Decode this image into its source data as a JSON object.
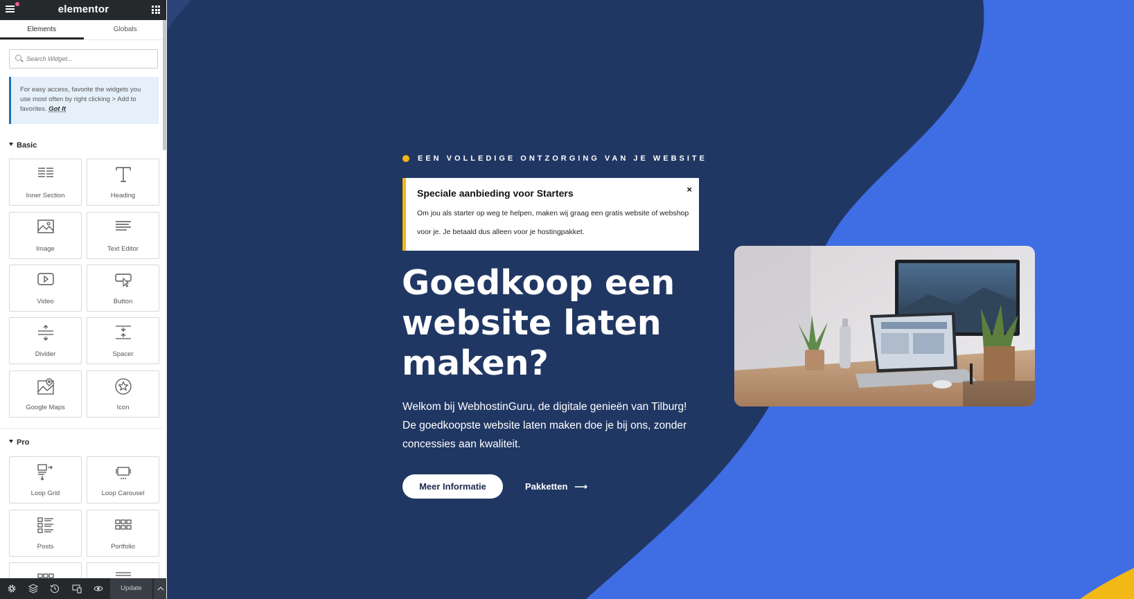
{
  "app": {
    "title": "elementor"
  },
  "panel": {
    "tabs": [
      {
        "label": "Elements",
        "active": true
      },
      {
        "label": "Globals",
        "active": false
      }
    ],
    "search": {
      "placeholder": "Search Widget..."
    },
    "notice": {
      "text": "For easy access, favorite the widgets you use most often by right clicking > Add to favorites.",
      "link": "Got It"
    },
    "categories": [
      {
        "title": "Basic",
        "widgets": [
          {
            "label": "Inner Section",
            "icon": "inner-section-icon"
          },
          {
            "label": "Heading",
            "icon": "heading-icon"
          },
          {
            "label": "Image",
            "icon": "image-icon"
          },
          {
            "label": "Text Editor",
            "icon": "text-editor-icon"
          },
          {
            "label": "Video",
            "icon": "video-icon"
          },
          {
            "label": "Button",
            "icon": "button-icon"
          },
          {
            "label": "Divider",
            "icon": "divider-icon"
          },
          {
            "label": "Spacer",
            "icon": "spacer-icon"
          },
          {
            "label": "Google Maps",
            "icon": "google-maps-icon"
          },
          {
            "label": "Icon",
            "icon": "star-icon"
          }
        ]
      },
      {
        "title": "Pro",
        "widgets": [
          {
            "label": "Loop Grid",
            "icon": "loop-grid-icon"
          },
          {
            "label": "Loop Carousel",
            "icon": "loop-carousel-icon"
          },
          {
            "label": "Posts",
            "icon": "posts-icon"
          },
          {
            "label": "Portfolio",
            "icon": "portfolio-icon"
          }
        ]
      }
    ],
    "footer": {
      "icons": [
        "settings-icon",
        "navigator-layers-icon",
        "history-icon",
        "responsive-mode-icon",
        "preview-eye-icon"
      ],
      "update_label": "Update"
    }
  },
  "hero": {
    "eyebrow": "EEN VOLLEDIGE ONTZORGING VAN JE WEBSITE",
    "alert": {
      "title": "Speciale aanbieding voor Starters",
      "body": "Om jou als starter op weg te helpen, maken wij graag een gratis website of webshop voor je. Je betaald dus alleen voor je hostingpakket.",
      "close": "×"
    },
    "title": "Goedkoop een website laten maken?",
    "description": "Welkom bij WebhostinGuru, de digitale genieën van Tilburg! De goedkoopste website laten maken doe je bij ons, zonder concessies aan kwaliteit.",
    "primary_button": "Meer Informatie",
    "secondary_button": "Pakketten",
    "secondary_arrow": "⟶"
  },
  "colors": {
    "canvas_bg": "#213763",
    "accent_blue": "#3c6be2",
    "accent_yellow": "#f1b816",
    "panel_dark": "#26292c"
  }
}
